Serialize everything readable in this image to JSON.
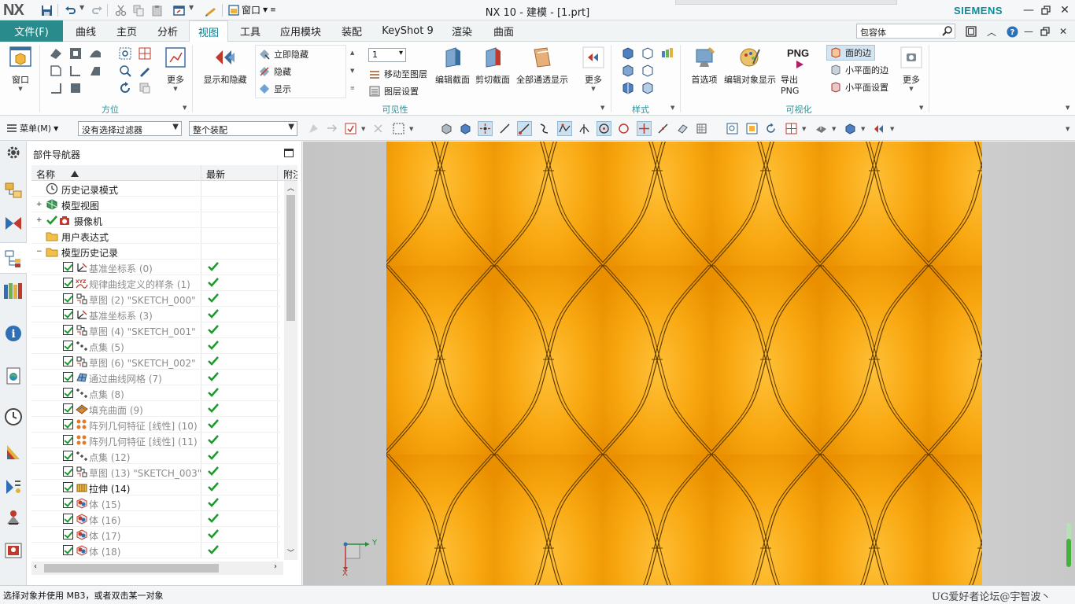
{
  "app": {
    "logo": "NX",
    "title": "NX 10 - 建模 - [1.prt]",
    "brand": "SIEMENS",
    "window_menu": "窗口"
  },
  "menu": {
    "file": "文件(F)",
    "tabs": [
      "曲线",
      "主页",
      "分析",
      "视图",
      "工具",
      "应用模块",
      "装配",
      "KeyShot 9",
      "渲染",
      "曲面"
    ],
    "active_tab": "视图",
    "search_value": "包容体"
  },
  "ribbon": {
    "window_label": "窗口",
    "more_label": "更多",
    "groups": {
      "orientation": "方位",
      "visibility": "可见性",
      "style": "样式",
      "visualization": "可视化"
    },
    "show_hide": "显示和隐藏",
    "immediate_hide": "立即隐藏",
    "hide": "隐藏",
    "show": "显示",
    "layer_value": "1",
    "move_to_layer": "移动至图层",
    "layer_settings": "图层设置",
    "edit_section": "编辑截面",
    "clip_section": "剪切截面",
    "all_transparent": "全部通透显示",
    "preferences": "首选项",
    "edit_object_display": "编辑对象显示",
    "export_png_big": "PNG",
    "export_png": "导出 PNG",
    "face_edges": "面的边",
    "small_plane_edges": "小平面的边",
    "small_plane_settings": "小平面设置"
  },
  "selection_bar": {
    "menu": "菜单(M)",
    "filter": "没有选择过滤器",
    "scope": "整个装配"
  },
  "navigator": {
    "title": "部件导航器",
    "columns": [
      "名称",
      "最新",
      "附注"
    ],
    "top_items": [
      "历史记录模式",
      "模型视图",
      "摄像机",
      "用户表达式",
      "模型历史记录"
    ],
    "features": [
      {
        "label": "基准坐标系 (0)",
        "icon": "datum-csys-icon",
        "gray": true
      },
      {
        "label": "规律曲线定义的样条 (1)",
        "icon": "law-curve-icon",
        "gray": true
      },
      {
        "label": "草图 (2) \"SKETCH_000\"",
        "icon": "sketch-icon",
        "gray": true
      },
      {
        "label": "基准坐标系 (3)",
        "icon": "datum-csys-icon",
        "gray": true
      },
      {
        "label": "草图 (4) \"SKETCH_001\"",
        "icon": "sketch-icon",
        "gray": true
      },
      {
        "label": "点集 (5)",
        "icon": "point-set-icon",
        "gray": true
      },
      {
        "label": "草图 (6) \"SKETCH_002\"",
        "icon": "sketch-icon",
        "gray": true
      },
      {
        "label": "通过曲线网格 (7)",
        "icon": "curve-mesh-icon",
        "gray": true
      },
      {
        "label": "点集 (8)",
        "icon": "point-set-icon",
        "gray": true
      },
      {
        "label": "填充曲面 (9)",
        "icon": "fill-surface-icon",
        "gray": true
      },
      {
        "label": "阵列几何特征 [线性] (10)",
        "icon": "pattern-geometry-icon",
        "gray": true
      },
      {
        "label": "阵列几何特征 [线性] (11)",
        "icon": "pattern-geometry-icon",
        "gray": true
      },
      {
        "label": "点集 (12)",
        "icon": "point-set-icon",
        "gray": true
      },
      {
        "label": "草图 (13) \"SKETCH_003\"",
        "icon": "sketch-icon",
        "gray": true
      },
      {
        "label": "拉伸 (14)",
        "icon": "extrude-icon",
        "gray": false
      },
      {
        "label": "体 (15)",
        "icon": "body-icon",
        "gray": true
      },
      {
        "label": "体 (16)",
        "icon": "body-icon",
        "gray": true
      },
      {
        "label": "体 (17)",
        "icon": "body-icon",
        "gray": true
      },
      {
        "label": "体 (18)",
        "icon": "body-icon",
        "gray": true
      }
    ]
  },
  "triad": {
    "y": "Y",
    "x": "X"
  },
  "status": {
    "prompt": "选择对象并使用 MB3，或者双击某一对象",
    "watermark": "UG爱好者论坛@宇智波丶"
  },
  "colors": {
    "accent": "#2a8b8c",
    "surface": "#f5a411",
    "check": "#1a9c2c"
  }
}
